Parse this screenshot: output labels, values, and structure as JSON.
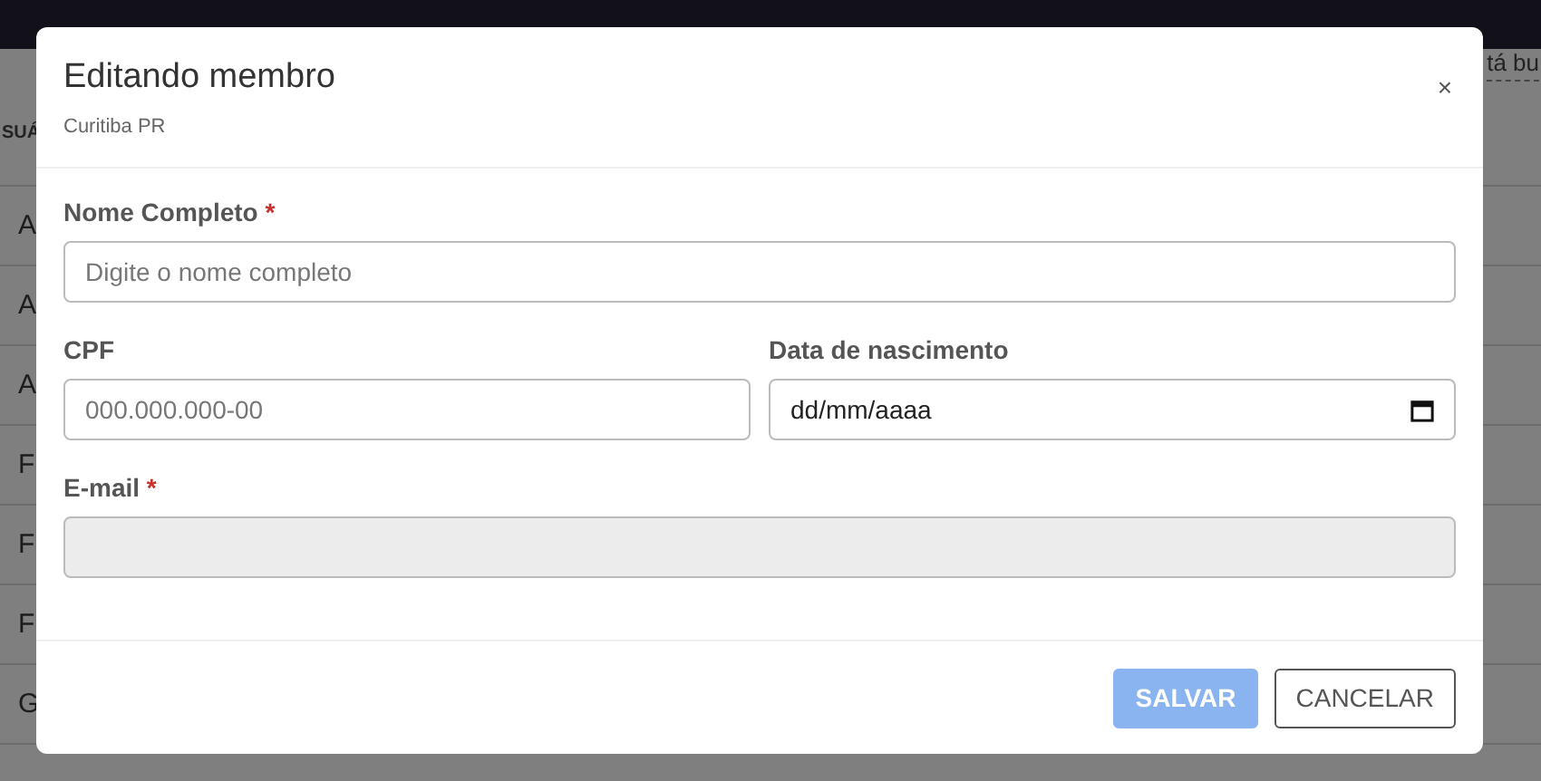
{
  "background": {
    "search_hint": "tá bu",
    "column_header": "SUÁ",
    "rows": [
      "A",
      "A",
      "A",
      "F",
      "F",
      "F",
      "G"
    ]
  },
  "modal": {
    "title": "Editando membro",
    "subtitle": "Curitiba PR",
    "close": "×",
    "field_rows": [
      [
        {
          "label": "Nome Completo",
          "required_mark": "*",
          "kind": "text",
          "placeholder": "Digite o nome completo",
          "disabled": false
        }
      ],
      [
        {
          "label": "CPF",
          "kind": "text",
          "placeholder": "000.000.000-00",
          "disabled": false
        },
        {
          "label": "Data de nascimento",
          "kind": "date",
          "placeholder": "dd/mm/aaaa",
          "disabled": false
        }
      ],
      [
        {
          "label": "E-mail",
          "required_mark": "*",
          "kind": "text",
          "disabled": true
        }
      ]
    ],
    "buttons": [
      {
        "label": "SALVAR",
        "kind": "primary",
        "disabled": true
      },
      {
        "label": "CANCELAR",
        "kind": "secondary",
        "disabled": false
      }
    ]
  }
}
